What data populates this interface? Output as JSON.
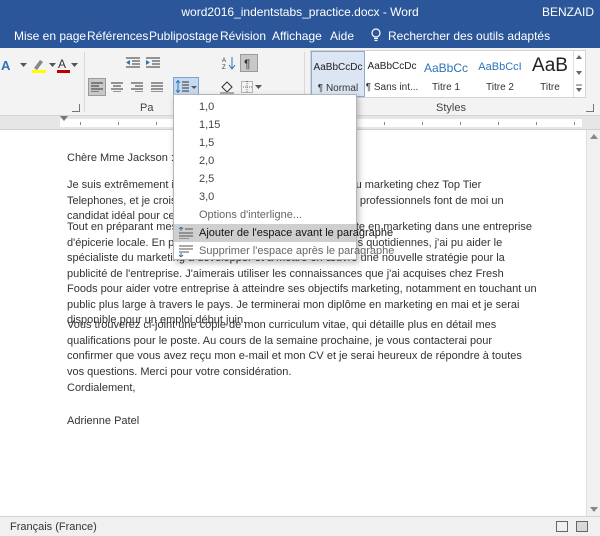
{
  "titlebar": {
    "document_title": "word2016_indentstabs_practice.docx - Word",
    "user": "BENZAID"
  },
  "ribbon_tabs": [
    {
      "label": "Mise en page"
    },
    {
      "label": "Références"
    },
    {
      "label": "Publipostage"
    },
    {
      "label": "Révision"
    },
    {
      "label": "Affichage"
    },
    {
      "label": "Aide"
    },
    {
      "label": "Rechercher des outils adaptés"
    }
  ],
  "groups": {
    "paragraph": "Pa",
    "styles": "Styles"
  },
  "styles_gallery": [
    {
      "sample": "AaBbCcDc",
      "name": "¶ Normal",
      "color": "#222222"
    },
    {
      "sample": "AaBbCcDc",
      "name": "¶ Sans int...",
      "color": "#222222"
    },
    {
      "sample": "AaBbCc",
      "name": "Titre 1",
      "color": "#2e74b5"
    },
    {
      "sample": "AaBbCcI",
      "name": "Titre 2",
      "color": "#2e74b5"
    },
    {
      "sample": "AaB",
      "name": "Titre",
      "color": "#222222"
    }
  ],
  "line_spacing_menu": {
    "options": [
      "1,0",
      "1,15",
      "1,5",
      "2,0",
      "2,5",
      "3,0"
    ],
    "line_spacing_options_label": "Options d'interligne...",
    "add_space_before": "Ajouter de l'espace avant le paragraphe",
    "remove_space_after": "Supprimer l'espace après le paragraphe"
  },
  "document": {
    "greeting": "Chère Mme Jackson :",
    "p1": "Je suis extrêmement intéressé par le poste de spécialiste du marketing chez Top Tier Telephones, et je crois que mes études et mes antécédents professionnels font de moi un candidat idéal pour ce poste.",
    "p2": "Tout en préparant mes études, j'ai travaillé comme assistante en marketing dans une entreprise d'épicerie locale. En plus d'aider l'entreprise dans ses tâches quotidiennes, j'ai pu aider le spécialiste du marketing à développer et à mettre en œuvre une nouvelle stratégie pour la publicité de l'entreprise. J'aimerais utiliser les connaissances que j'ai acquises chez Fresh Foods pour aider votre entreprise à atteindre ses objectifs marketing, notamment en touchant un public plus large à travers le pays. Je terminerai mon diplôme en marketing en mai et je serai disponible pour un emploi début juin.",
    "p3": "Vous trouverez ci-joint une copie de mon curriculum vitae, qui détaille plus en détail mes qualifications pour le poste. Au cours de la semaine prochaine, je vous contacterai pour confirmer que vous avez reçu mon e-mail et mon CV et je serai heureux de répondre à toutes vos questions. Merci pour votre considération.",
    "closing": "Cordialement,",
    "signature": "Adrienne Patel"
  },
  "statusbar": {
    "language": "Français (France)"
  },
  "colors": {
    "word_blue": "#2b579a",
    "heading_blue": "#2e74b5",
    "font_red": "#c00000"
  }
}
